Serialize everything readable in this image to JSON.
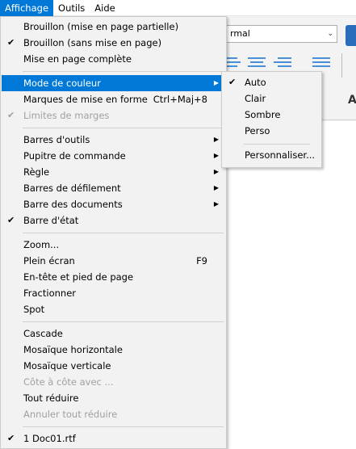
{
  "menubar": {
    "items": [
      "Affichage",
      "Outils",
      "Aide"
    ]
  },
  "background": {
    "style_combo_value": "rmal",
    "bold_letter": "A"
  },
  "menu": {
    "items": {
      "draft_partial": "Brouillon (mise en page partielle)",
      "draft_no_layout": "Brouillon (sans mise en page)",
      "full_layout": "Mise en page complète",
      "color_mode": "Mode de couleur",
      "format_marks": "Marques de mise en forme",
      "format_marks_shortcut": "Ctrl+Maj+8",
      "margin_limits": "Limites de marges",
      "toolbars": "Barres d'outils",
      "command_desk": "Pupitre de commande",
      "ruler": "Règle",
      "scrollbars": "Barres de défilement",
      "doc_bar": "Barre des documents",
      "status_bar": "Barre d'état",
      "zoom": "Zoom...",
      "fullscreen": "Plein écran",
      "fullscreen_shortcut": "F9",
      "header_footer": "En-tête et pied de page",
      "split": "Fractionner",
      "spot": "Spot",
      "cascade": "Cascade",
      "tile_h": "Mosaïque horizontale",
      "tile_v": "Mosaïque verticale",
      "side_by_side": "Côte à côte avec ...",
      "minimize_all": "Tout réduire",
      "restore_all": "Annuler tout réduire",
      "doc1": "1 Doc01.rtf"
    },
    "check_glyph": "✔",
    "submenu_arrow": "▶"
  },
  "submenu": {
    "auto": "Auto",
    "light": "Clair",
    "dark": "Sombre",
    "custom": "Perso",
    "customize": "Personnaliser..."
  },
  "colors": {
    "highlight": "#0078d7",
    "menu_bg": "#f2f2f2",
    "disabled_text": "#a0a0a0"
  }
}
